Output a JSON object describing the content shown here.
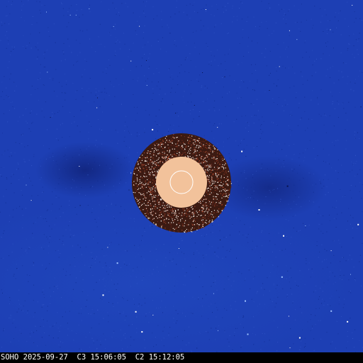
{
  "image": {
    "observatory": "SOHO",
    "date": "2025-09-27",
    "c3_label": "C3",
    "c3_time": "15:06:05",
    "c2_label": "C2",
    "c2_time": "15:12:05"
  },
  "colors": {
    "sky": "#1d3fb4",
    "inner_field": "#3b1a12",
    "occulter": "#f2c29b",
    "sun_circle": "#ffffff",
    "status_bar": "#000000",
    "caption_text": "#ffffff"
  }
}
